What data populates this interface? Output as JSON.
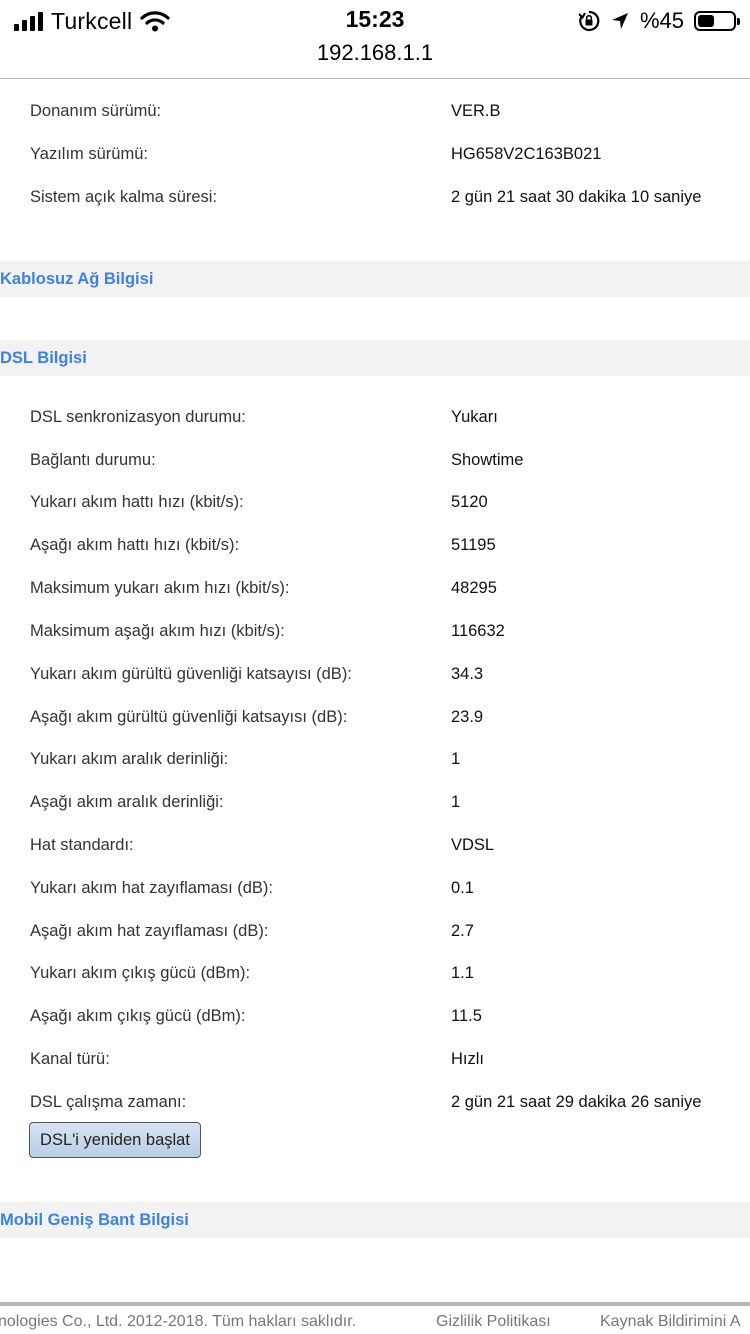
{
  "status_bar": {
    "carrier": "Turkcell",
    "time": "15:23",
    "battery_percent": "%45",
    "icons": [
      "signal-icon",
      "wifi-icon",
      "orientation-lock-icon",
      "location-icon",
      "battery-icon"
    ]
  },
  "browser": {
    "url": "192.168.1.1"
  },
  "device_info": [
    {
      "label": "Donanım sürümü:",
      "value": "VER.B"
    },
    {
      "label": "Yazılım sürümü:",
      "value": "HG658V2C163B021"
    },
    {
      "label": "Sistem açık kalma süresi:",
      "value": "2 gün 21 saat 30 dakika 10 saniye"
    }
  ],
  "sections": {
    "wireless": "Kablosuz Ağ Bilgisi",
    "dsl": "DSL Bilgisi",
    "mobile": "Mobil Geniş Bant Bilgisi"
  },
  "dsl_info": [
    {
      "label": "DSL senkronizasyon durumu:",
      "value": "Yukarı"
    },
    {
      "label": "Bağlantı durumu:",
      "value": "Showtime"
    },
    {
      "label": "Yukarı akım hattı hızı (kbit/s):",
      "value": "5120"
    },
    {
      "label": "Aşağı akım hattı hızı (kbit/s):",
      "value": "51195"
    },
    {
      "label": "Maksimum yukarı akım hızı (kbit/s):",
      "value": "48295"
    },
    {
      "label": "Maksimum aşağı akım hızı (kbit/s):",
      "value": "116632"
    },
    {
      "label": "Yukarı akım gürültü güvenliği katsayısı (dB):",
      "value": "34.3"
    },
    {
      "label": "Aşağı akım gürültü güvenliği katsayısı (dB):",
      "value": "23.9"
    },
    {
      "label": "Yukarı akım aralık derinliği:",
      "value": "1"
    },
    {
      "label": "Aşağı akım aralık derinliği:",
      "value": "1"
    },
    {
      "label": "Hat standardı:",
      "value": "VDSL"
    },
    {
      "label": "Yukarı akım hat zayıflaması (dB):",
      "value": "0.1"
    },
    {
      "label": "Aşağı akım hat zayıflaması (dB):",
      "value": "2.7"
    },
    {
      "label": "Yukarı akım çıkış gücü (dBm):",
      "value": "1.1"
    },
    {
      "label": "Aşağı akım çıkış gücü (dBm):",
      "value": "11.5"
    },
    {
      "label": "Kanal türü:",
      "value": "Hızlı"
    },
    {
      "label": "DSL çalışma zamanı:",
      "value": "2 gün 21 saat 29 dakika 26 saniye"
    }
  ],
  "restart_button": "DSL'i yeniden başlat",
  "footer": {
    "copyright": "nologies Co., Ltd. 2012-2018. Tüm hakları saklıdır.",
    "privacy": "Gizlilik Politikası",
    "source_report": "Kaynak Bildirimini A"
  },
  "colors": {
    "section_title": "#3c82e6",
    "section_bg": "#f2f2f2",
    "button_bg": "#c8d8ee"
  }
}
